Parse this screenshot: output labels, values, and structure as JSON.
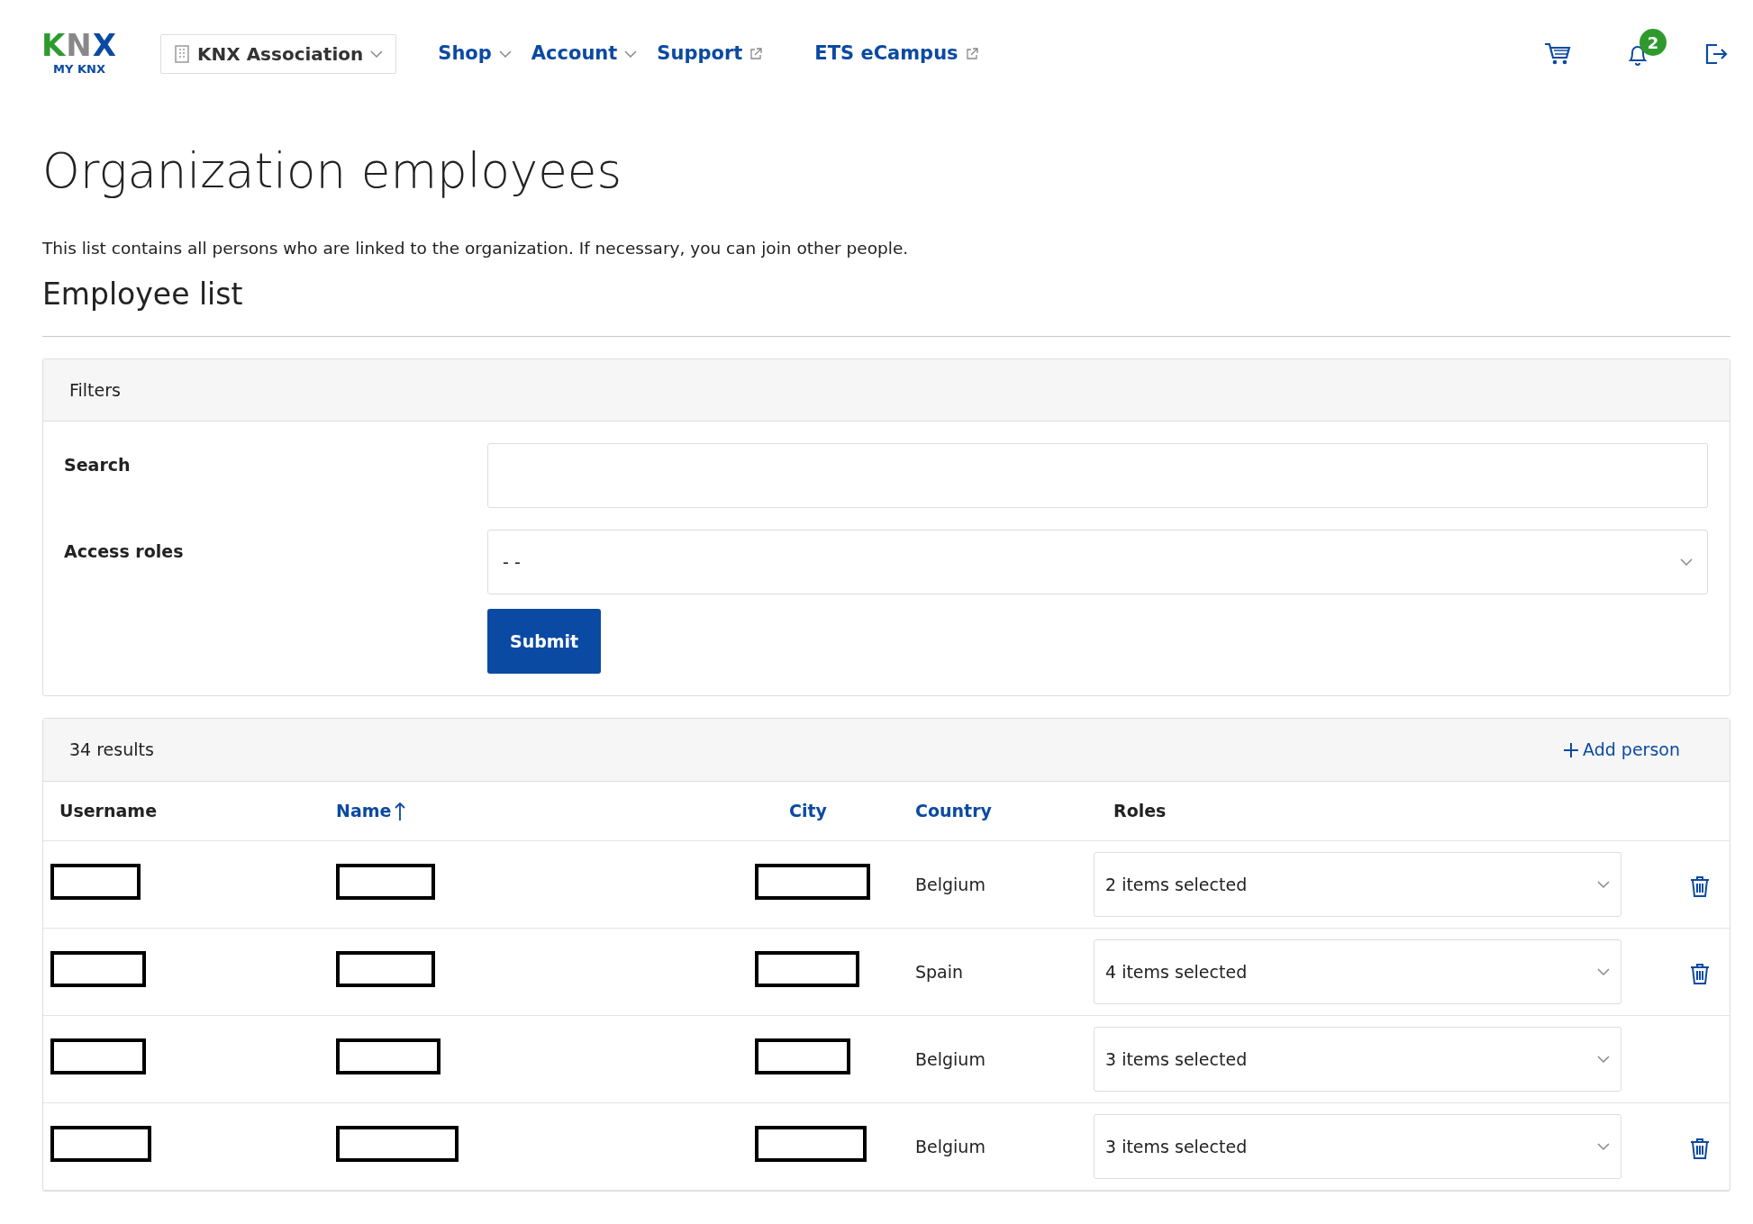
{
  "header": {
    "logo": {
      "mark": "KNX",
      "subtitle": "MY KNX"
    },
    "organization": "KNX Association",
    "nav": [
      {
        "label": "Shop",
        "kind": "dropdown"
      },
      {
        "label": "Account",
        "kind": "dropdown"
      },
      {
        "label": "Support",
        "kind": "external"
      },
      {
        "label": "ETS eCampus",
        "kind": "external"
      }
    ],
    "notifications": "2"
  },
  "title": "Organization employees",
  "description": "This list contains all persons who are linked to the organization. If necessary, you can join other people.",
  "section_title": "Employee list",
  "filters": {
    "title": "Filters",
    "fields": [
      {
        "label": "Search",
        "kind": "text"
      },
      {
        "label": "Access roles",
        "kind": "select",
        "value": "- -"
      }
    ],
    "submit": "Submit"
  },
  "results": {
    "count": "34 results",
    "add": "Add person",
    "columns": [
      {
        "label": "Username",
        "sortable": false,
        "sorted": false
      },
      {
        "label": "Name",
        "sortable": true,
        "sorted": true
      },
      {
        "label": "City",
        "sortable": true,
        "sorted": false
      },
      {
        "label": "Country",
        "sortable": true,
        "sorted": false
      },
      {
        "label": "Roles",
        "sortable": false,
        "sorted": false
      }
    ],
    "rows": [
      {
        "country": "Belgium",
        "roles": "2 items selected",
        "deletable": true
      },
      {
        "country": "Spain",
        "roles": "4 items selected",
        "deletable": true
      },
      {
        "country": "Belgium",
        "roles": "3 items selected",
        "deletable": false
      },
      {
        "country": "Belgium",
        "roles": "3 items selected",
        "deletable": true
      }
    ]
  }
}
